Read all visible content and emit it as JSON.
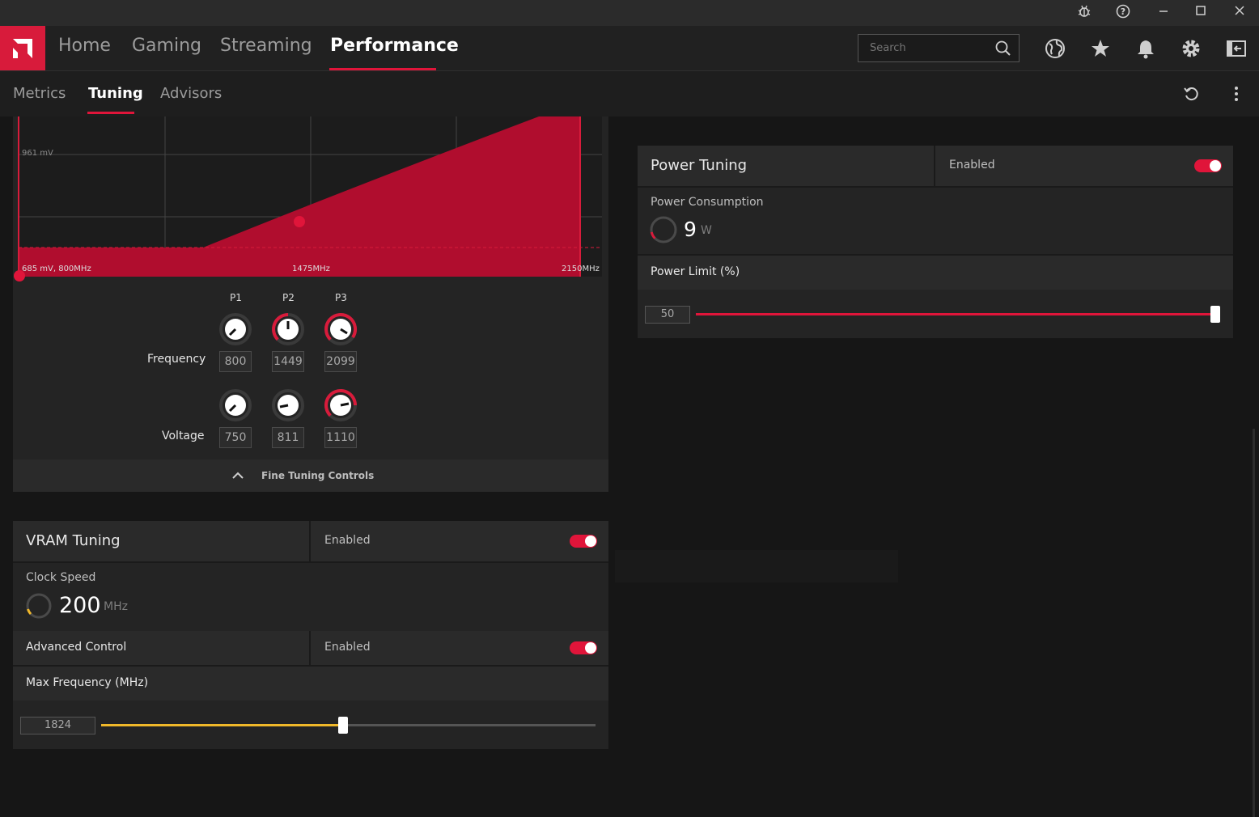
{
  "titlebar": {
    "icons": [
      "bug-report-icon",
      "help-icon",
      "minimize-icon",
      "maximize-icon",
      "close-icon"
    ]
  },
  "nav": {
    "tabs": [
      {
        "label": "Home"
      },
      {
        "label": "Gaming"
      },
      {
        "label": "Streaming"
      },
      {
        "label": "Performance"
      }
    ],
    "active": "Performance",
    "search_placeholder": "Search",
    "icons": [
      "globe-icon",
      "star-icon",
      "bell-icon",
      "gear-icon",
      "sidebar-toggle-icon"
    ]
  },
  "subnav": {
    "tabs": [
      {
        "label": "Metrics"
      },
      {
        "label": "Tuning"
      },
      {
        "label": "Advisors"
      }
    ],
    "active": "Tuning",
    "icons": [
      "reset-icon",
      "more-options-icon"
    ]
  },
  "curve": {
    "top_label": "961 mV",
    "bottom_left_label": "685 mV, 800MHz",
    "mid_label": "1475MHz",
    "right_label": "2150MHz"
  },
  "fine_tuning": {
    "states": [
      "P1",
      "P2",
      "P3"
    ],
    "frequency_label": "Frequency",
    "voltage_label": "Voltage",
    "frequency_values": [
      "800",
      "1449",
      "2099"
    ],
    "voltage_values": [
      "750",
      "811",
      "1110"
    ],
    "collapse_label": "Fine Tuning Controls"
  },
  "vram": {
    "title": "VRAM Tuning",
    "status": "Enabled",
    "clock_label": "Clock Speed",
    "clock_value": "200",
    "clock_unit": "MHz",
    "advanced_label": "Advanced Control",
    "advanced_status": "Enabled",
    "max_freq_label": "Max Frequency (MHz)",
    "max_freq_value": "1824",
    "slider_fraction": 0.49
  },
  "power": {
    "title": "Power Tuning",
    "status": "Enabled",
    "consumption_label": "Power Consumption",
    "consumption_value": "9",
    "consumption_unit": "W",
    "limit_label": "Power Limit (%)",
    "limit_value": "50",
    "slider_fraction": 1.0
  },
  "colors": {
    "accent": "#e0153a",
    "curve_fill": "#b00d2e",
    "vram_slider": "#f0b82a",
    "background": "#161616",
    "panel": "#242424"
  }
}
